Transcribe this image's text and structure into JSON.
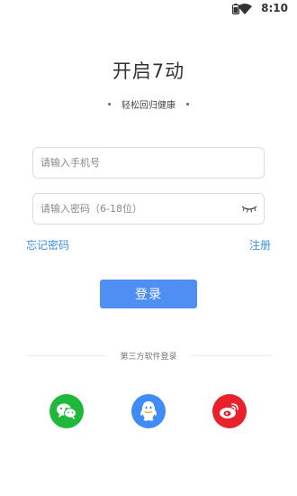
{
  "status_bar": {
    "time": "8:10"
  },
  "header": {
    "title": "开启7动",
    "subtitle": "轻松回归健康"
  },
  "form": {
    "phone_placeholder": "请输入手机号",
    "password_placeholder": "请输入密码（6-18位）",
    "forgot_label": "忘记密码",
    "register_label": "注册",
    "login_label": "登录"
  },
  "third_party": {
    "label": "第三方软件登录",
    "providers": [
      "wechat-icon",
      "qq-icon",
      "weibo-icon"
    ]
  },
  "colors": {
    "accent": "#4f8ff3",
    "link": "#3d8fd9",
    "wechat": "#20b83a",
    "qq": "#3f8cf4",
    "weibo": "#e8212a"
  }
}
